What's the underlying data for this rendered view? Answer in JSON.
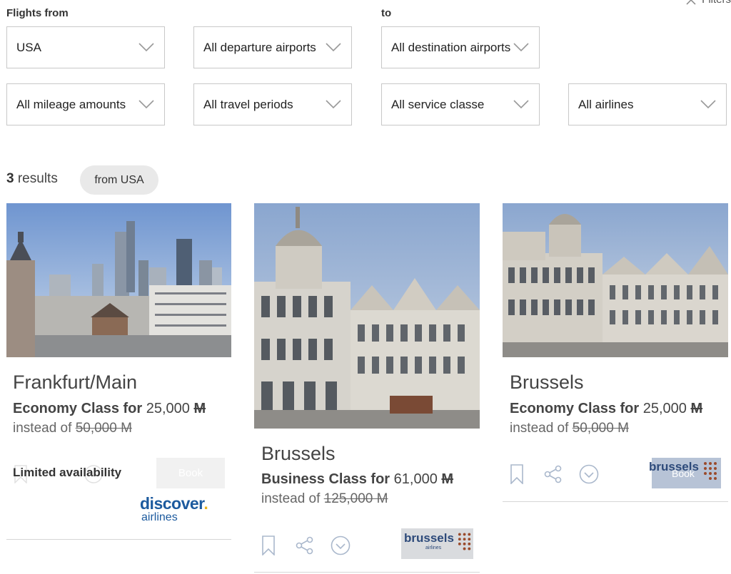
{
  "filters": {
    "from_label": "Flights from",
    "to_label": "to",
    "filters_link": "Filters",
    "country": "USA",
    "departure": "All departure airports",
    "destination": "All destination airports",
    "mileage": "All mileage amounts",
    "periods": "All travel periods",
    "service": "All service classe",
    "airlines": "All airlines"
  },
  "results": {
    "count": "3",
    "label": "results",
    "chip": "from USA"
  },
  "cards": [
    {
      "city": "Frankfurt/Main",
      "class_text": "Economy Class for",
      "miles": "25,000",
      "unit": "M",
      "instead": "instead of",
      "old_miles": "50,000 M",
      "availability": "Limited availability",
      "book": "Book",
      "airline_logo": "discover",
      "airline_logo_sub": "airlines"
    },
    {
      "city": "Brussels",
      "class_text": "Business Class for",
      "miles": "61,000",
      "unit": "M",
      "instead": "instead of",
      "old_miles": "125,000 M",
      "airline_logo": "brussels",
      "airline_logo_sub": "airlines"
    },
    {
      "city": "Brussels",
      "class_text": "Economy Class for",
      "miles": "25,000",
      "unit": "M",
      "instead": "instead of",
      "old_miles": "50,000 M",
      "book": "Book",
      "airline_logo": "brussels"
    }
  ],
  "colors": {
    "discover_blue": "#1c5a9e",
    "brussels_brown": "#9a4b2c",
    "border": "#c8c8c8",
    "chip_bg": "#e9e9e9"
  }
}
